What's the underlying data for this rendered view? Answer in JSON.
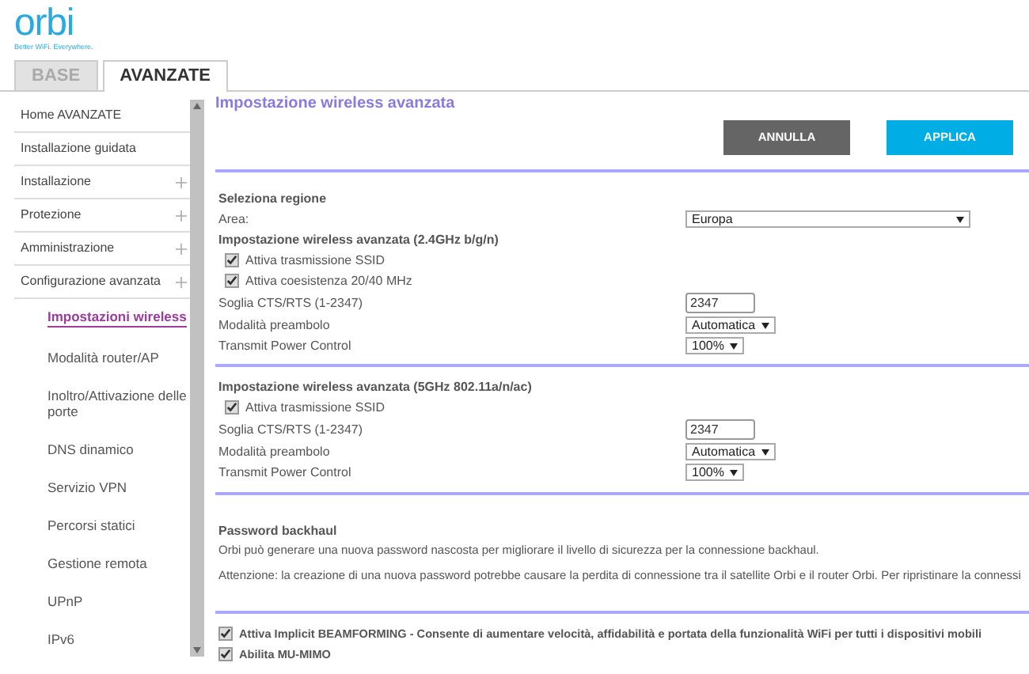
{
  "logo": {
    "name": "orbi",
    "tagline": "Better WiFi. Everywhere."
  },
  "tabs": [
    {
      "label": "BASE",
      "selected": false
    },
    {
      "label": "AVANZATE",
      "selected": true
    }
  ],
  "sidebar": {
    "items": [
      {
        "label": "Home AVANZATE",
        "expandable": false
      },
      {
        "label": "Installazione guidata",
        "expandable": false
      },
      {
        "label": "Installazione",
        "expandable": true
      },
      {
        "label": "Protezione",
        "expandable": true
      },
      {
        "label": "Amministrazione",
        "expandable": true
      },
      {
        "label": "Configurazione avanzata",
        "expandable": true,
        "children": [
          {
            "label": "Impostazioni wireless",
            "selected": true
          },
          {
            "label": "Modalità router/AP",
            "selected": false
          },
          {
            "label": "Inoltro/Attivazione delle porte",
            "selected": false
          },
          {
            "label": "DNS dinamico",
            "selected": false
          },
          {
            "label": "Servizio VPN",
            "selected": false
          },
          {
            "label": "Percorsi statici",
            "selected": false
          },
          {
            "label": "Gestione remota",
            "selected": false
          },
          {
            "label": "UPnP",
            "selected": false
          },
          {
            "label": "IPv6",
            "selected": false
          }
        ]
      }
    ]
  },
  "main": {
    "title": "Impostazione wireless avanzata",
    "buttons": [
      {
        "label": "ANNULLA",
        "kind": "secondary"
      },
      {
        "label": "APPLICA",
        "kind": "primary"
      }
    ],
    "sections": [
      {
        "rows": [
          {
            "kind": "heading",
            "label": "Seleziona regione"
          },
          {
            "kind": "regionselect",
            "label": "Area:",
            "value": "Europa"
          },
          {
            "kind": "heading",
            "label": "Impostazione wireless avanzata (2.4GHz b/g/n)"
          },
          {
            "kind": "checkbox",
            "label": "Attiva trasmissione SSID",
            "checked": true
          },
          {
            "kind": "checkbox",
            "label": "Attiva coesistenza 20/40 MHz",
            "checked": true
          },
          {
            "kind": "input",
            "label": "Soglia CTS/RTS (1-2347)",
            "value": "2347"
          },
          {
            "kind": "select",
            "label": "Modalità preambolo",
            "value": "Automatica"
          },
          {
            "kind": "select",
            "label": "Transmit Power Control",
            "value": "100%"
          }
        ]
      },
      {
        "rows": [
          {
            "kind": "heading",
            "label": "Impostazione wireless avanzata (5GHz 802.11a/n/ac)"
          },
          {
            "kind": "checkbox",
            "label": "Attiva trasmissione SSID",
            "checked": true
          },
          {
            "kind": "input",
            "label": "Soglia CTS/RTS (1-2347)",
            "value": "2347"
          },
          {
            "kind": "select",
            "label": "Modalità preambolo",
            "value": "Automatica"
          },
          {
            "kind": "select",
            "label": "Transmit Power Control",
            "value": "100%"
          }
        ]
      },
      {
        "rows": [
          {
            "kind": "heading",
            "label": "Password backhaul"
          },
          {
            "kind": "text",
            "label": "Orbi può generare una nuova password nascosta per migliorare il livello di sicurezza per la connessione backhaul."
          },
          {
            "kind": "text",
            "label": "Attenzione: la creazione di una nuova password potrebbe causare la perdita di connessione tra il satellite Orbi e il router Orbi. Per ripristinare la connessi"
          }
        ]
      },
      {
        "rows": [
          {
            "kind": "checkbox",
            "label": "Attiva Implicit BEAMFORMING - Consente di aumentare velocità, affidabilità e portata della funzionalità WiFi per tutti i dispositivi mobili",
            "checked": true,
            "bold": true
          },
          {
            "kind": "checkbox",
            "label": "Abilita MU-MIMO",
            "checked": true,
            "bold": true
          }
        ]
      }
    ]
  }
}
